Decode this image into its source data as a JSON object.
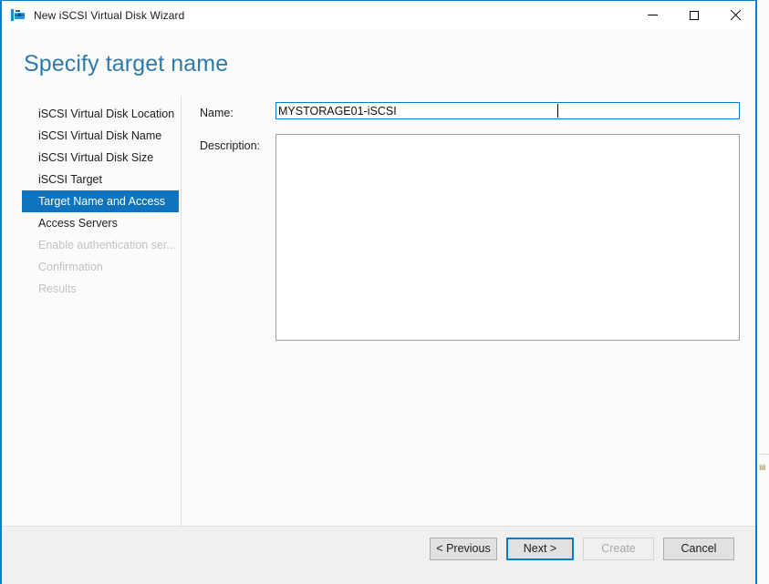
{
  "window": {
    "title": "New iSCSI Virtual Disk Wizard",
    "icon": "wizard-toolbox-icon",
    "accent_color": "#0a7cc8",
    "controls": {
      "minimize": "minimize-icon",
      "maximize": "maximize-icon",
      "close": "close-icon"
    }
  },
  "page": {
    "title": "Specify target name",
    "title_color": "#2e7aab"
  },
  "sidebar": {
    "selected_color": "#0f74bd",
    "items": [
      {
        "label": "iSCSI Virtual Disk Location",
        "state": "normal"
      },
      {
        "label": "iSCSI Virtual Disk Name",
        "state": "normal"
      },
      {
        "label": "iSCSI Virtual Disk Size",
        "state": "normal"
      },
      {
        "label": "iSCSI Target",
        "state": "normal"
      },
      {
        "label": "Target Name and Access",
        "state": "selected"
      },
      {
        "label": "Access Servers",
        "state": "normal"
      },
      {
        "label": "Enable authentication ser...",
        "state": "disabled"
      },
      {
        "label": "Confirmation",
        "state": "disabled"
      },
      {
        "label": "Results",
        "state": "disabled"
      }
    ]
  },
  "form": {
    "name_label": "Name:",
    "name_value": "MYSTORAGE01-iSCSI",
    "name_placeholder": "",
    "description_label": "Description:",
    "description_value": "",
    "description_placeholder": ""
  },
  "footer": {
    "buttons": [
      {
        "label": "< Previous",
        "state": "normal"
      },
      {
        "label": "Next >",
        "state": "default"
      },
      {
        "label": "Create",
        "state": "disabled"
      },
      {
        "label": "Cancel",
        "state": "normal"
      }
    ]
  }
}
